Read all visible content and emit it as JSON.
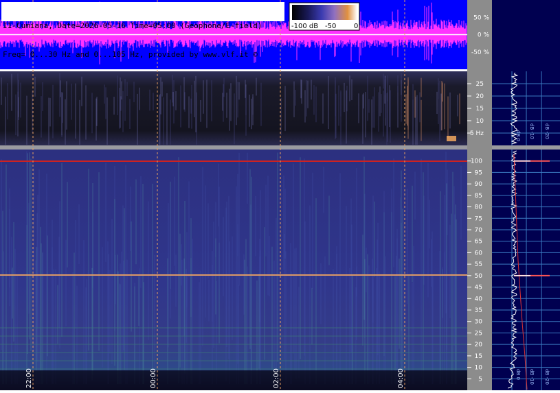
{
  "header": {
    "line1": "I1-Cumiana, Date=2026-05-16 Time=05:00 (Geophone/E-field)",
    "line2": "Freq= 0...30 Hz and 0...105 Hz, provided by www.vlf.it ©"
  },
  "colorbar": {
    "ticks": [
      "-100 dB",
      "-50",
      "0"
    ],
    "colors": [
      "#000000",
      "#1a1a5a",
      "#3a3ab0",
      "#9070c0",
      "#e09040",
      "#ffffff"
    ]
  },
  "colors": {
    "waveform_bg": "#0000ff",
    "waveform_signal": "#ff33ff",
    "spectrogram_bg": "#2a2a6a",
    "right_panel_bg": "#000050",
    "mains_line": "#cc2222",
    "gridline": "#e8a060"
  },
  "chart_data": [
    {
      "type": "line",
      "name": "amplitude",
      "yticks": [
        "50 %",
        "0 %",
        "-50 %"
      ],
      "ylim": [
        -100,
        100
      ],
      "y_values": [
        50,
        0,
        -50
      ]
    },
    {
      "type": "heatmap",
      "name": "low-band-spectrogram",
      "ylabel": "Hz",
      "ylim": [
        0,
        30
      ],
      "yticks": [
        "25",
        "20",
        "15",
        "10",
        "5 Hz"
      ],
      "ytick_values": [
        25,
        20,
        15,
        10,
        5
      ]
    },
    {
      "type": "heatmap",
      "name": "high-band-spectrogram",
      "ylim": [
        0,
        105
      ],
      "yticks": [
        "100",
        "95",
        "90",
        "85",
        "80",
        "75",
        "70",
        "65",
        "60",
        "55",
        "50",
        "45",
        "40",
        "35",
        "30",
        "25",
        "20",
        "15",
        "10",
        "5"
      ],
      "ytick_values": [
        100,
        95,
        90,
        85,
        80,
        75,
        70,
        65,
        60,
        55,
        50,
        45,
        40,
        35,
        30,
        25,
        20,
        15,
        10,
        5
      ],
      "time_labels": [
        "22:00",
        "00:00",
        "02:00",
        "04:00"
      ],
      "mains_lines_hz": [
        100,
        50
      ]
    },
    {
      "type": "line",
      "name": "average-spectrum",
      "xticks_upper": [
        "dB 0",
        "dB -10",
        "dB -20"
      ],
      "xticks_lower": [
        "dB 0",
        "dB -10",
        "dB -20"
      ],
      "peaks_hz": [
        100,
        50
      ]
    }
  ]
}
